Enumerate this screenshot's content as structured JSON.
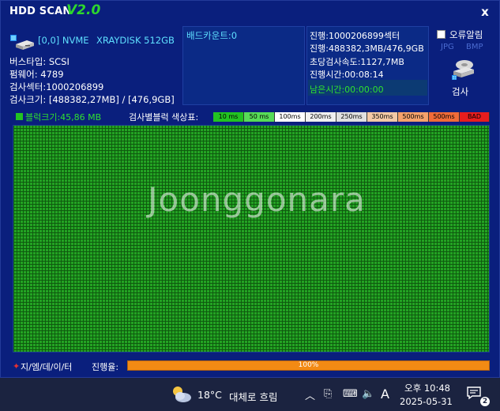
{
  "window": {
    "title": "HDD SCAN",
    "version": "V2.0",
    "close_symbol": "x"
  },
  "disk": {
    "id": "[0,0] NVME",
    "model": "XRAYDISK 512GB",
    "bus_type": "버스타입: SCSI",
    "firmware": "펌웨어: 4789",
    "sectors": "검사섹터:1000206899",
    "size": "검사크기: [488382,27MB] / [476,9GB]"
  },
  "bad_count": "배드카운트:0",
  "progress_info": {
    "line1": "진행:1000206899섹터",
    "line2": "진행:488382,3MB/476,9GB",
    "speed": "초당검사속도:1127,7MB",
    "elapsed": "진행시간:00:08:14",
    "remaining": "남은시간:00:00:00"
  },
  "options": {
    "error_alarm": "오류알림",
    "jpg": "JPG",
    "bmp": "BMP",
    "scan_button": "검사"
  },
  "block_size": "블럭크기:45,86 MB",
  "legend": {
    "title": "검사별블럭 색상표:",
    "items": [
      {
        "label": "10 ms",
        "color": "#22c322"
      },
      {
        "label": "50 ms",
        "color": "#57dc57"
      },
      {
        "label": "100ms",
        "color": "#ffffff"
      },
      {
        "label": "200ms",
        "color": "#f0f0f0"
      },
      {
        "label": "250ms",
        "color": "#e0e0e0"
      },
      {
        "label": "350ms",
        "color": "#f3c9a6"
      },
      {
        "label": "500ms",
        "color": "#f5a26b"
      },
      {
        "label": "500ms",
        "color": "#f06b38"
      },
      {
        "label": "BAD",
        "color": "#e81d1d"
      }
    ]
  },
  "watermark": "Joonggonara",
  "footer": {
    "brand": "지/엠/데/이/터",
    "progress_label": "진행율:",
    "progress_value": 100,
    "progress_text": "100%"
  },
  "taskbar": {
    "temperature": "18°C",
    "weather": "대체로 흐림",
    "ime": "A",
    "ampm_time": "오후 10:48",
    "date": "2025-05-31",
    "notification_count": "2"
  }
}
